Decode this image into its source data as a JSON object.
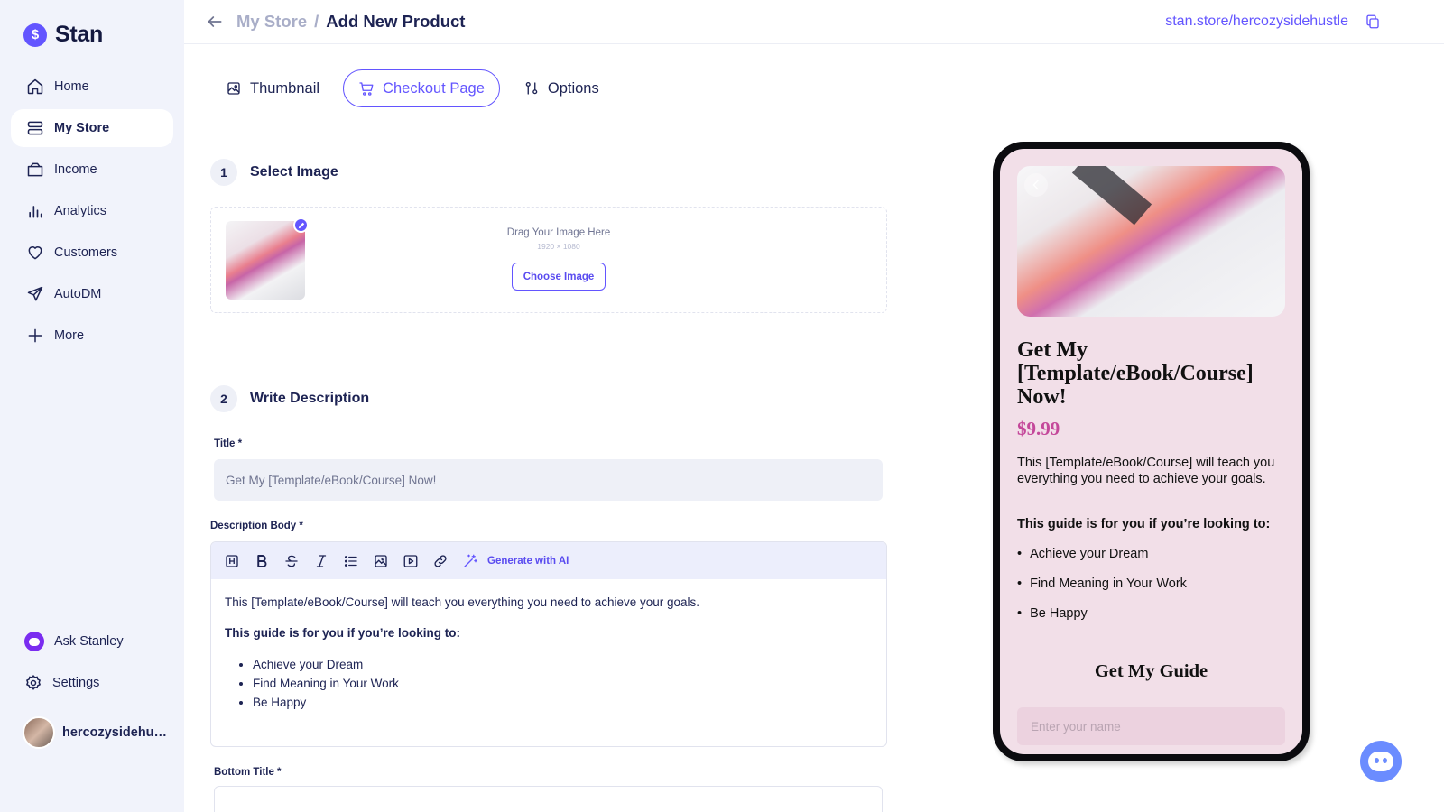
{
  "brand": {
    "name": "Stan",
    "logo_glyph": "$"
  },
  "sidebar": {
    "items": [
      {
        "label": "Home",
        "icon": "home-icon"
      },
      {
        "label": "My Store",
        "icon": "store-icon",
        "active": true
      },
      {
        "label": "Income",
        "icon": "wallet-icon"
      },
      {
        "label": "Analytics",
        "icon": "bar-chart-icon"
      },
      {
        "label": "Customers",
        "icon": "heart-icon"
      },
      {
        "label": "AutoDM",
        "icon": "send-icon"
      },
      {
        "label": "More",
        "icon": "plus-icon"
      }
    ],
    "ask": "Ask Stanley",
    "settings": "Settings",
    "user": "hercozysidehustle"
  },
  "header": {
    "crumb_parent": "My Store",
    "crumb_sep": "/",
    "crumb_current": "Add New Product",
    "store_url": "stan.store/hercozysidehustle"
  },
  "tabs": [
    {
      "label": "Thumbnail",
      "icon": "image-icon"
    },
    {
      "label": "Checkout Page",
      "icon": "cart-icon",
      "active": true
    },
    {
      "label": "Options",
      "icon": "options-icon"
    }
  ],
  "step1": {
    "num": "1",
    "title": "Select Image"
  },
  "dropzone": {
    "text": "Drag Your Image Here",
    "dims": "1920 × 1080",
    "button": "Choose Image"
  },
  "step2": {
    "num": "2",
    "title": "Write Description"
  },
  "form": {
    "title_label": "Title *",
    "title_value": "Get My [Template/eBook/Course] Now!",
    "desc_label": "Description Body *",
    "ai_label": "Generate with AI",
    "desc_para": "This [Template/eBook/Course] will teach you everything you need to achieve your goals.",
    "desc_strong": "This guide is for you if you’re looking to:",
    "desc_list": [
      "Achieve your Dream",
      "Find Meaning in Your Work",
      "Be Happy"
    ],
    "bottom_label": "Bottom Title *"
  },
  "preview": {
    "title": "Get My [Template/eBook/Course] Now!",
    "price": "$9.99",
    "desc": "This [Template/eBook/Course] will teach you everything you need to achieve your goals.",
    "sub": "This guide is for you if you’re looking to:",
    "list": [
      "Achieve your Dream",
      "Find Meaning in Your Work",
      "Be Happy"
    ],
    "cta": "Get My Guide",
    "name_placeholder": "Enter your name"
  },
  "colors": {
    "accent": "#6355ff",
    "sidebar_bg": "#f1f3fb",
    "preview_bg": "#f2dfe8",
    "price": "#c4489a"
  }
}
